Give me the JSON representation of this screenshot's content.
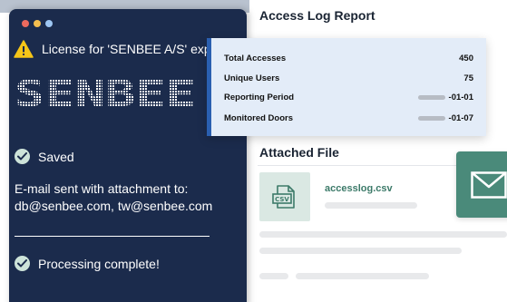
{
  "app": {
    "license_text": "License for 'SENBEE A/S' exp",
    "logo_text": "SENBEE",
    "saved_label": "Saved",
    "email_text": "E-mail sent with attachment to: db@senbee.com, tw@senbee.com",
    "processing_label": "Processing complete!"
  },
  "report": {
    "title": "Access Log Report",
    "stats": [
      {
        "label": "Total Accesses",
        "value": "450"
      },
      {
        "label": "Unique Users",
        "value": "75"
      },
      {
        "label": "Reporting Period",
        "value": "-01-01"
      },
      {
        "label": "Monitored Doors",
        "value": "-01-07"
      }
    ],
    "attached_title": "Attached File",
    "file_name": "accesslog.csv",
    "file_icon_label": "CSV"
  },
  "colors": {
    "window_bg": "#1b2b4c",
    "card_bg": "#e3ecf8",
    "card_accent": "#2a5fb0",
    "file_accent": "#3c7a69",
    "mail_tile": "#4a8a7a",
    "warning": "#f5c518"
  },
  "icons": [
    "warning-icon",
    "check-icon",
    "csv-file-icon",
    "mail-icon"
  ]
}
